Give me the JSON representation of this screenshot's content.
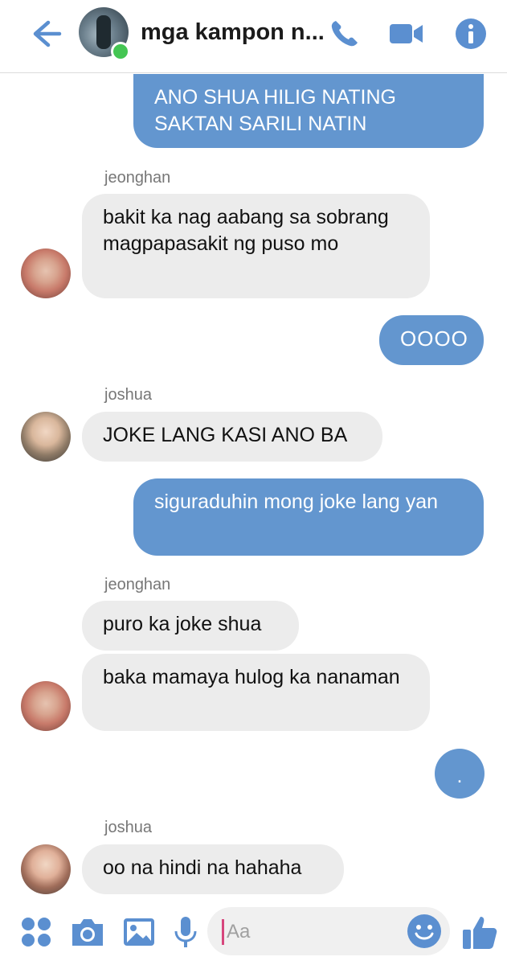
{
  "header": {
    "title": "mga kampon n...",
    "icons": [
      "back-arrow-icon",
      "phone-icon",
      "video-icon",
      "info-icon"
    ],
    "status": "online"
  },
  "messages": [
    {
      "type": "outgoing",
      "text": "ANO SHUA HILIG NATING SAKTAN SARILI NATIN"
    },
    {
      "type": "incoming",
      "sender": "jeonghan",
      "text": "bakit ka nag aabang sa sobrang magpapasakit ng puso mo"
    },
    {
      "type": "outgoing",
      "text": "OOOO"
    },
    {
      "type": "incoming",
      "sender": "joshua",
      "text": "JOKE LANG KASI ANO BA"
    },
    {
      "type": "outgoing",
      "text": "siguraduhin mong joke lang yan"
    },
    {
      "type": "incoming",
      "sender": "jeonghan",
      "text": "puro ka joke shua"
    },
    {
      "type": "incoming",
      "text": "baka mamaya hulog ka nanaman"
    },
    {
      "type": "outgoing",
      "text": "."
    },
    {
      "type": "incoming",
      "sender": "joshua",
      "text": "oo na hindi na hahaha"
    }
  ],
  "composer": {
    "placeholder": "Aa",
    "icons": [
      "apps-icon",
      "camera-icon",
      "gallery-icon",
      "microphone-icon",
      "emoji-icon",
      "thumbs-up-icon"
    ]
  },
  "colors": {
    "accent": "#6396cf",
    "incoming_bubble": "#ececec",
    "online": "#44c553"
  }
}
